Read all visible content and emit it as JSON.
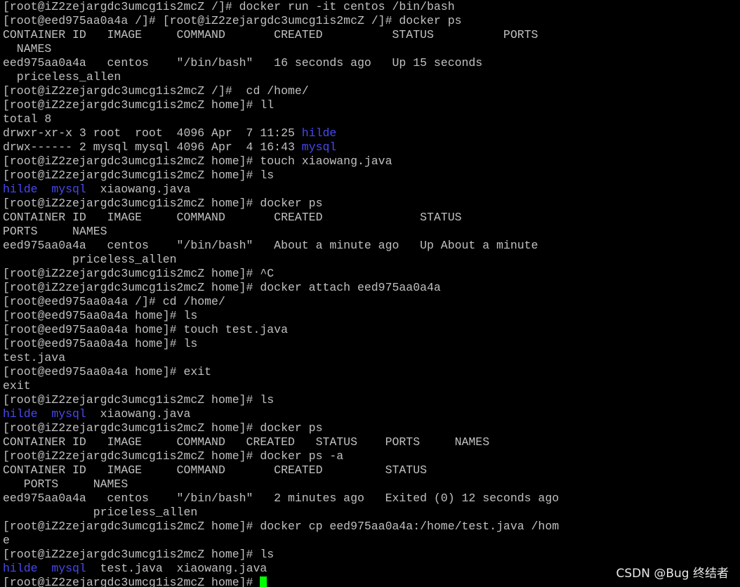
{
  "terminal": {
    "lines": [
      "[root@iZ2zejargdc3umcg1is2mcZ /]# docker run -it centos /bin/bash",
      "[root@eed975aa0a4a /]# [root@iZ2zejargdc3umcg1is2mcZ /]# docker ps",
      "CONTAINER ID   IMAGE     COMMAND       CREATED          STATUS          PORTS",
      "  NAMES",
      "eed975aa0a4a   centos    \"/bin/bash\"   16 seconds ago   Up 15 seconds",
      "  priceless_allen",
      "[root@iZ2zejargdc3umcg1is2mcZ /]#  cd /home/",
      "[root@iZ2zejargdc3umcg1is2mcZ home]# ll",
      "total 8",
      "drwxr-xr-x 3 root  root  4096 Apr  7 11:25 ",
      "drwx------ 2 mysql mysql 4096 Apr  4 16:43 ",
      "[root@iZ2zejargdc3umcg1is2mcZ home]# touch xiaowang.java",
      "[root@iZ2zejargdc3umcg1is2mcZ home]# ls",
      "  xiaowang.java",
      "[root@iZ2zejargdc3umcg1is2mcZ home]# docker ps",
      "CONTAINER ID   IMAGE     COMMAND       CREATED              STATUS",
      "PORTS     NAMES",
      "eed975aa0a4a   centos    \"/bin/bash\"   About a minute ago   Up About a minute",
      "          priceless_allen",
      "[root@iZ2zejargdc3umcg1is2mcZ home]# ^C",
      "[root@iZ2zejargdc3umcg1is2mcZ home]# docker attach eed975aa0a4a",
      "[root@eed975aa0a4a /]# cd /home/",
      "[root@eed975aa0a4a home]# ls",
      "[root@eed975aa0a4a home]# touch test.java",
      "[root@eed975aa0a4a home]# ls",
      "test.java",
      "[root@eed975aa0a4a home]# exit",
      "exit",
      "[root@iZ2zejargdc3umcg1is2mcZ home]# ls",
      "  xiaowang.java",
      "[root@iZ2zejargdc3umcg1is2mcZ home]# docker ps",
      "CONTAINER ID   IMAGE     COMMAND   CREATED   STATUS    PORTS     NAMES",
      "[root@iZ2zejargdc3umcg1is2mcZ home]# docker ps -a",
      "CONTAINER ID   IMAGE     COMMAND       CREATED         STATUS",
      "   PORTS     NAMES",
      "eed975aa0a4a   centos    \"/bin/bash\"   2 minutes ago   Exited (0) 12 seconds ago",
      "             priceless_allen",
      "[root@iZ2zejargdc3umcg1is2mcZ home]# docker cp eed975aa0a4a:/home/test.java /hom",
      "e",
      "[root@iZ2zejargdc3umcg1is2mcZ home]# ls",
      "  test.java  xiaowang.java",
      "[root@iZ2zejargdc3umcg1is2mcZ home]# "
    ],
    "dir_hilde": "hilde",
    "dir_mysql": "mysql"
  },
  "watermark": "CSDN @Bug 终结者",
  "colors": {
    "background": "#000000",
    "foreground": "#c0c0c0",
    "directory": "#4848f0",
    "cursor": "#00ff00"
  },
  "icons": {
    "cursor": "block-cursor"
  }
}
